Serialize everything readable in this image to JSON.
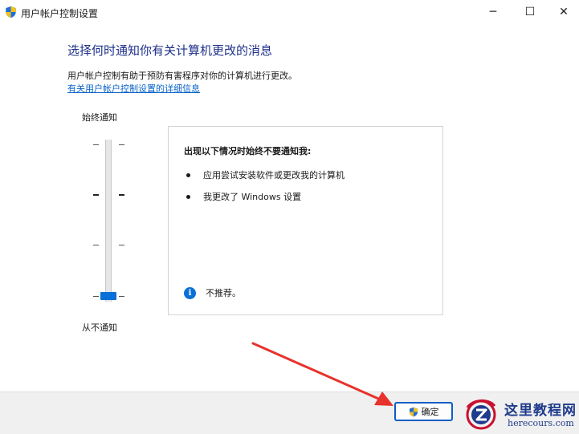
{
  "window": {
    "title": "用户帐户控制设置",
    "controls": {
      "minimize": "─",
      "maximize": "☐",
      "close": "✕"
    }
  },
  "main": {
    "heading": "选择何时通知你有关计算机更改的消息",
    "description": "用户帐户控制有助于预防有害程序对你的计算机进行更改。",
    "link_text": "有关用户帐户控制设置的详细信息"
  },
  "slider": {
    "top_label": "始终通知",
    "bottom_label": "从不通知",
    "levels": 4,
    "selected_level": 1,
    "selected_level_description": "lowest of 4 levels (Never notify)"
  },
  "panel": {
    "title": "出现以下情况时始终不要通知我:",
    "items": [
      "应用尝试安装软件或更改我的计算机",
      "我更改了 Windows 设置"
    ],
    "recommendation": "不推荐。"
  },
  "footer": {
    "ok_label": "确定"
  },
  "watermark": {
    "title": "这里教程网",
    "subtitle": "herecours.com"
  },
  "colors": {
    "heading": "#1c2f8a",
    "link": "#0a64c8",
    "accent": "#0a6fd6",
    "arrow": "#e8322c"
  }
}
